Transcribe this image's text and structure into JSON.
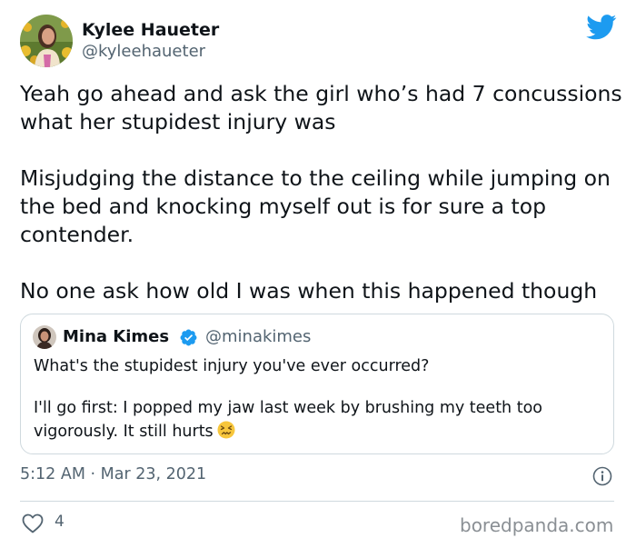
{
  "author": {
    "name": "Kylee Haueter",
    "handle": "@kyleehaueter"
  },
  "tweet": {
    "paragraphs": [
      "Yeah go ahead and ask the girl who’s had 7 concussions what her stupidest injury was",
      "Misjudging the distance to the ceiling while jumping on the bed and knocking myself out is for sure a top contender.",
      "No one ask how old I was when this happened though"
    ]
  },
  "quoted": {
    "name": "Mina Kimes",
    "handle": "@minakimes",
    "paragraphs": [
      "What's the stupidest injury you've ever occurred?",
      "I'll go first: I popped my jaw last week by brushing my teeth too vigorously. It still hurts"
    ],
    "emoji_icon": "confounded-face-icon"
  },
  "meta": {
    "timestamp": "5:12 AM · Mar 23, 2021",
    "like_count": "4"
  },
  "watermark": "boredpanda.com",
  "colors": {
    "twitter_blue": "#1d9bf0",
    "text": "#0f1419",
    "secondary": "#536471",
    "border": "#cfd9de"
  },
  "icons": {
    "brand": "twitter-bird-icon",
    "verified": "verified-badge-icon",
    "info": "info-icon",
    "like": "heart-icon"
  }
}
